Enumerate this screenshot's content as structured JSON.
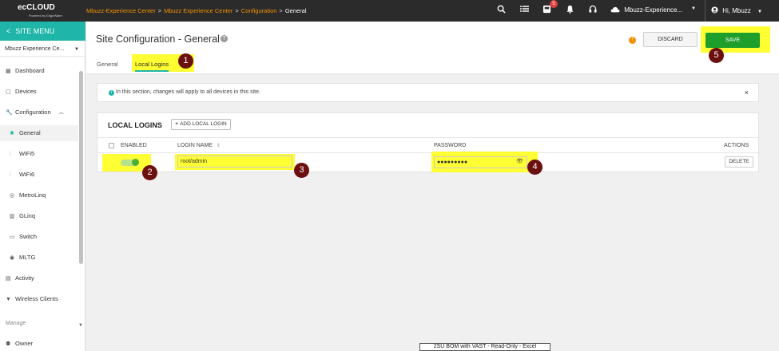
{
  "topbar": {
    "logo_text": "ecCLOUD",
    "logo_sub": "Powered by EdgeWater",
    "breadcrumbs": [
      "Mbuzz-Experience Center",
      "Mbuzz Experience Center",
      "Configuration",
      "General"
    ],
    "notification_count": "5",
    "site_name": "Mbuzz-Experience...",
    "user_greeting": "Hi, Mbuzz"
  },
  "sidebar": {
    "menu_title": "SITE MENU",
    "site_select": "Mbuzz Experience Ce...",
    "items": [
      {
        "label": "Dashboard"
      },
      {
        "label": "Devices"
      },
      {
        "label": "Configuration"
      },
      {
        "label": "General"
      },
      {
        "label": "WiFi5"
      },
      {
        "label": "WiFi6"
      },
      {
        "label": "MetroLinq"
      },
      {
        "label": "GLinq"
      },
      {
        "label": "Switch"
      },
      {
        "label": "MLTG"
      },
      {
        "label": "Activity"
      },
      {
        "label": "Wireless Clients"
      }
    ],
    "section_manage": "Manage",
    "owner": "Owner"
  },
  "header": {
    "title": "Site Configuration - General",
    "tabs": [
      {
        "label": "General"
      },
      {
        "label": "Local Logins"
      }
    ],
    "discard_label": "DISCARD",
    "save_label": "SAVE"
  },
  "annotations": [
    "1",
    "2",
    "3",
    "4",
    "5"
  ],
  "info": {
    "text": "In this section, changes will apply to all devices in this site."
  },
  "local_logins": {
    "title": "LOCAL LOGINS",
    "add_label": "ADD LOCAL LOGIN",
    "columns": {
      "enabled": "ENABLED",
      "login_name": "LOGIN NAME",
      "password": "PASSWORD",
      "actions": "ACTIONS"
    },
    "row": {
      "login_name": "root/admin",
      "password": "●●●●●●●●●",
      "delete_label": "DELETE"
    }
  },
  "taskbar_tooltip": "2SU BOM with VAST  -  Read-Only - Excel",
  "colors": {
    "accent": "#1fb5a9",
    "save": "#1e9e2a",
    "highlight": "#ffff33",
    "annotation": "#6b0f0f",
    "breadcrumb": "#f39200"
  }
}
